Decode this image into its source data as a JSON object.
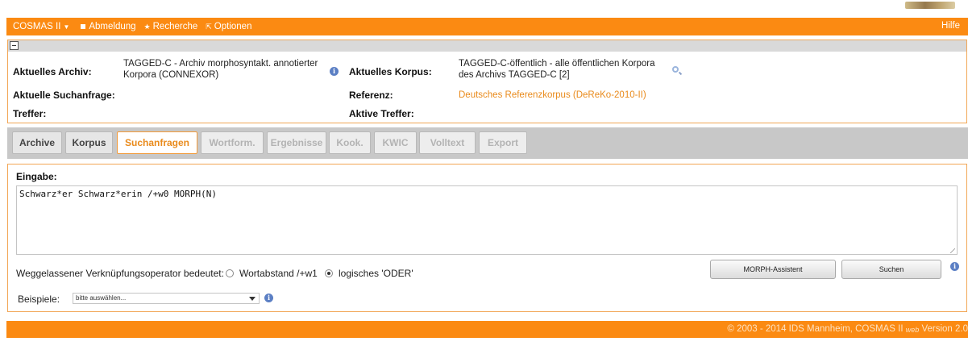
{
  "nav": {
    "app_menu": "COSMAS II",
    "logout": "Abmeldung",
    "research": "Recherche",
    "options": "Optionen",
    "help": "Hilfe"
  },
  "info": {
    "archive_label": "Aktuelles Archiv:",
    "archive_value_line1": "TAGGED-C - Archiv morphosyntakt. annotierter",
    "archive_value_line2": "Korpora (CONNEXOR)",
    "corpus_label": "Aktuelles Korpus:",
    "corpus_value_line1": "TAGGED-C-öffentlich - alle öffentlichen Korpora",
    "corpus_value_line2": "des Archivs TAGGED-C [2]",
    "query_label": "Aktuelle Suchanfrage:",
    "reference_label": "Referenz:",
    "reference_value": "Deutsches Referenzkorpus (DeReKo-2010-II)",
    "hits_label": "Treffer:",
    "active_hits_label": "Aktive Treffer:",
    "info_glyph": "i"
  },
  "tabs": [
    {
      "label": "Archive",
      "state": "enabled"
    },
    {
      "label": "Korpus",
      "state": "enabled"
    },
    {
      "label": "Suchanfragen",
      "state": "active"
    },
    {
      "label": "Wortform.",
      "state": "disabled"
    },
    {
      "label": "Ergebnisse",
      "state": "disabled"
    },
    {
      "label": "Kook.",
      "state": "disabled"
    },
    {
      "label": "KWIC",
      "state": "disabled"
    },
    {
      "label": "Volltext",
      "state": "disabled"
    },
    {
      "label": "Export",
      "state": "disabled"
    }
  ],
  "query": {
    "input_label": "Eingabe:",
    "input_value": "Schwarz*er Schwarz*erin /+w0 MORPH(N)",
    "operator_label": "Weggelassener Verknüpfungsoperator bedeutet:",
    "option_distance": "Wortabstand /+w1",
    "option_or": "logisches 'ODER'",
    "selected_option": "option_or",
    "morph_button": "MORPH-Assistent",
    "search_button": "Suchen",
    "examples_label": "Beispiele:",
    "examples_select": "bitte auswählen..."
  },
  "footer": {
    "copyright": "© 2003 - 2014 IDS Mannheim, COSMAS II",
    "web": "web",
    "version": "Version 2.0"
  },
  "colors": {
    "accent": "#fb8a12",
    "link": "#e98a1b",
    "info_icon": "#5b7fc4"
  }
}
